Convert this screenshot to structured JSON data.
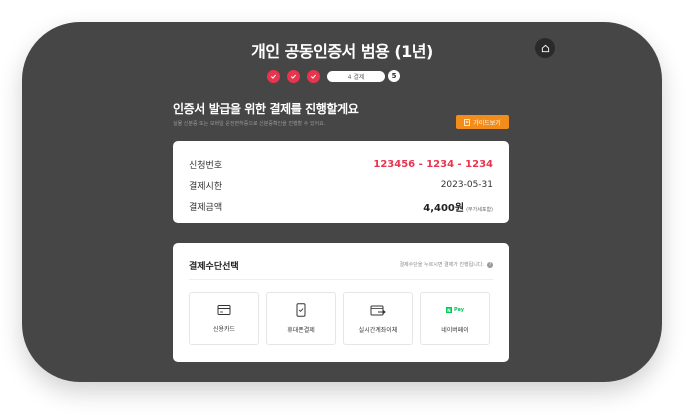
{
  "header": {
    "title": "개인 공동인증서 범용 (1년)"
  },
  "steps": {
    "current_label": "4 결제",
    "next_label": "5"
  },
  "intro": {
    "heading": "인증서 발급을 위한 결제를 진행할게요",
    "subtext": "실물 신분증 또는 모바일 운전면허증으로 신분증확인을 진행할 수 있어요.",
    "guide_button": "가이드보기"
  },
  "info": {
    "rows": [
      {
        "label": "신청번호",
        "value": "123456 - 1234 - 1234"
      },
      {
        "label": "결제시한",
        "value": "2023-05-31"
      },
      {
        "label": "결제금액",
        "value": "4,400원",
        "note": "(부가세포함)"
      }
    ]
  },
  "payment": {
    "title": "결제수단선택",
    "hint": "결제수단을 누르시면 결제가 진행됩니다.",
    "methods": [
      {
        "label": "신용카드",
        "icon": "credit-card-icon"
      },
      {
        "label": "휴대폰결제",
        "icon": "mobile-phone-icon"
      },
      {
        "label": "실시간계좌이체",
        "icon": "bank-transfer-icon"
      },
      {
        "label": "네이버페이",
        "icon": "naver-pay-icon",
        "logo_text": "Pay"
      }
    ]
  },
  "colors": {
    "accent_red": "#e8344e",
    "guide_orange": "#f28c1b",
    "naver_green": "#03c75a",
    "background": "#464646"
  }
}
